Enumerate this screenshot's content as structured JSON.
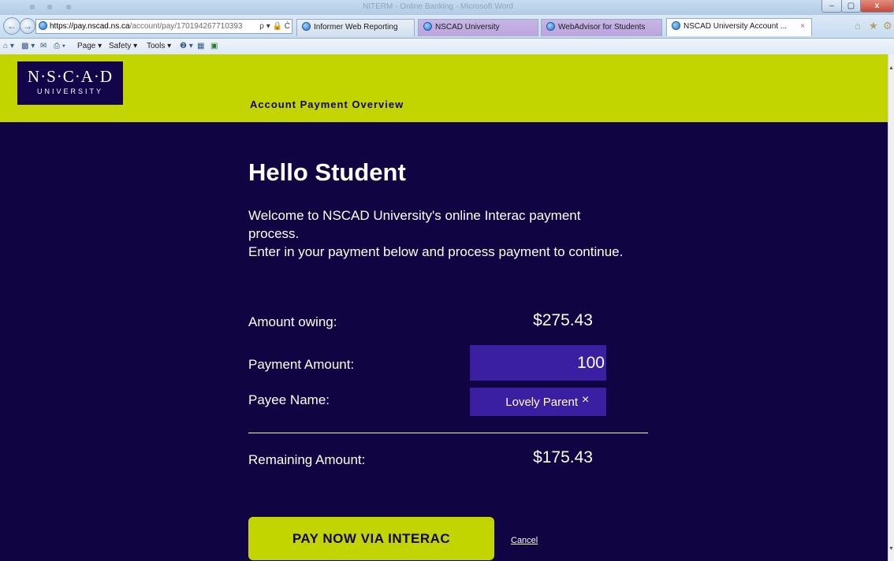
{
  "browser": {
    "window_title": "NITERM - Online Banking - Microsoft Word",
    "window_controls": {
      "minimize": "–",
      "maximize": "▢",
      "close": "x"
    },
    "address": {
      "host": "https://pay.nscad.ns.ca",
      "path": "/account/pay/170194267710393",
      "tools": "ρ ▾ 🔒 Ċ"
    },
    "tabs": [
      {
        "label": "Informer Web Reporting"
      },
      {
        "label": "NSCAD University"
      },
      {
        "label": "WebAdvisor for Students"
      },
      {
        "label": "NSCAD University Account ...",
        "close": "×"
      }
    ],
    "nav_right_icons": {
      "home": "⌂",
      "favorites": "★",
      "tools": "⚙"
    },
    "command_bar": {
      "page": "Page ▾",
      "safety": "Safety ▾",
      "tools": "Tools ▾",
      "help": "❷ ▾"
    },
    "icons": {
      "back": "arrow-left",
      "forward": "arrow-right",
      "home": "home",
      "feeds": "rss",
      "mail": "mail",
      "print": "print"
    }
  },
  "header": {
    "logo_name": "N·S·C·A·D",
    "logo_sub": "UNIVERSITY",
    "title": "Account Payment Overview"
  },
  "content": {
    "greeting": "Hello Student",
    "welcome_line1": "Welcome to NSCAD University's online Interac payment process.",
    "welcome_line2": "Enter in your payment below and process payment to continue.",
    "amount_owing": {
      "label": "Amount owing:",
      "value": "$275.43"
    },
    "payment_amount": {
      "label": "Payment Amount:",
      "value": "100"
    },
    "payee_name": {
      "label": "Payee Name:",
      "value": "Lovely Parent",
      "clear": "×"
    },
    "remaining": {
      "label": "Remaining Amount:",
      "value": "$175.43"
    },
    "pay_button": "PAY NOW VIA INTERAC",
    "cancel": "Cancel"
  },
  "colors": {
    "header_bg": "#c2d500",
    "page_bg": "#100443",
    "input_bg": "#3b1fa3",
    "button_bg": "#c2d500",
    "text_dark": "#12054a"
  }
}
